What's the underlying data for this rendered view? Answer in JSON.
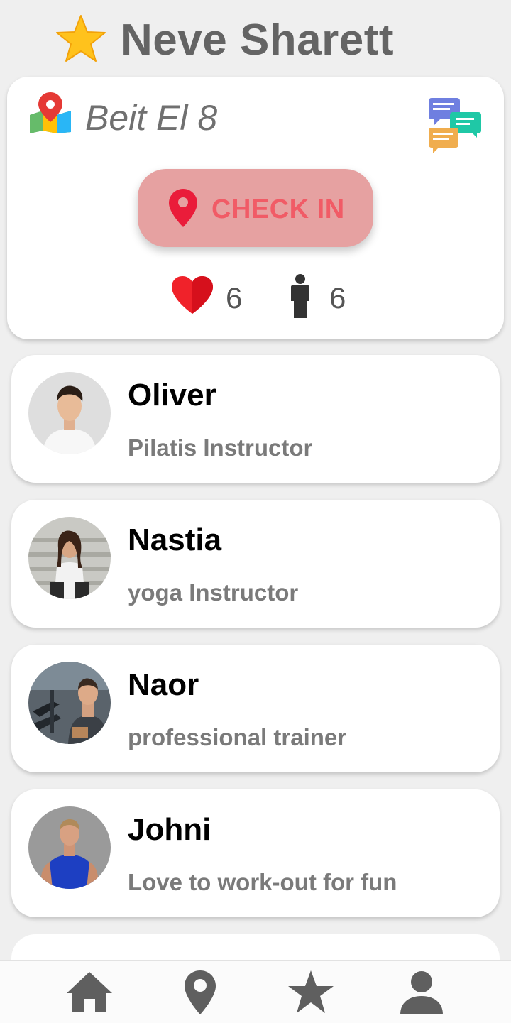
{
  "header": {
    "title": "Neve Sharett",
    "icon": "star-icon"
  },
  "location": {
    "address": "Beit El 8",
    "checkin_label": "CHECK IN",
    "likes": "6",
    "people": "6"
  },
  "trainers": [
    {
      "name": "Oliver",
      "role": "Pilatis Instructor"
    },
    {
      "name": "Nastia",
      "role": "yoga Instructor"
    },
    {
      "name": "Naor",
      "role": "professional trainer"
    },
    {
      "name": "Johni",
      "role": "Love to work-out for fun"
    }
  ],
  "nav": {
    "items": [
      "home-icon",
      "location-pin-icon",
      "star-icon",
      "profile-icon"
    ]
  },
  "colors": {
    "background": "#efefef",
    "checkin_button": "#e6a1a1",
    "checkin_text": "#f15b66",
    "heart": "#f0222a",
    "title": "#646464"
  }
}
